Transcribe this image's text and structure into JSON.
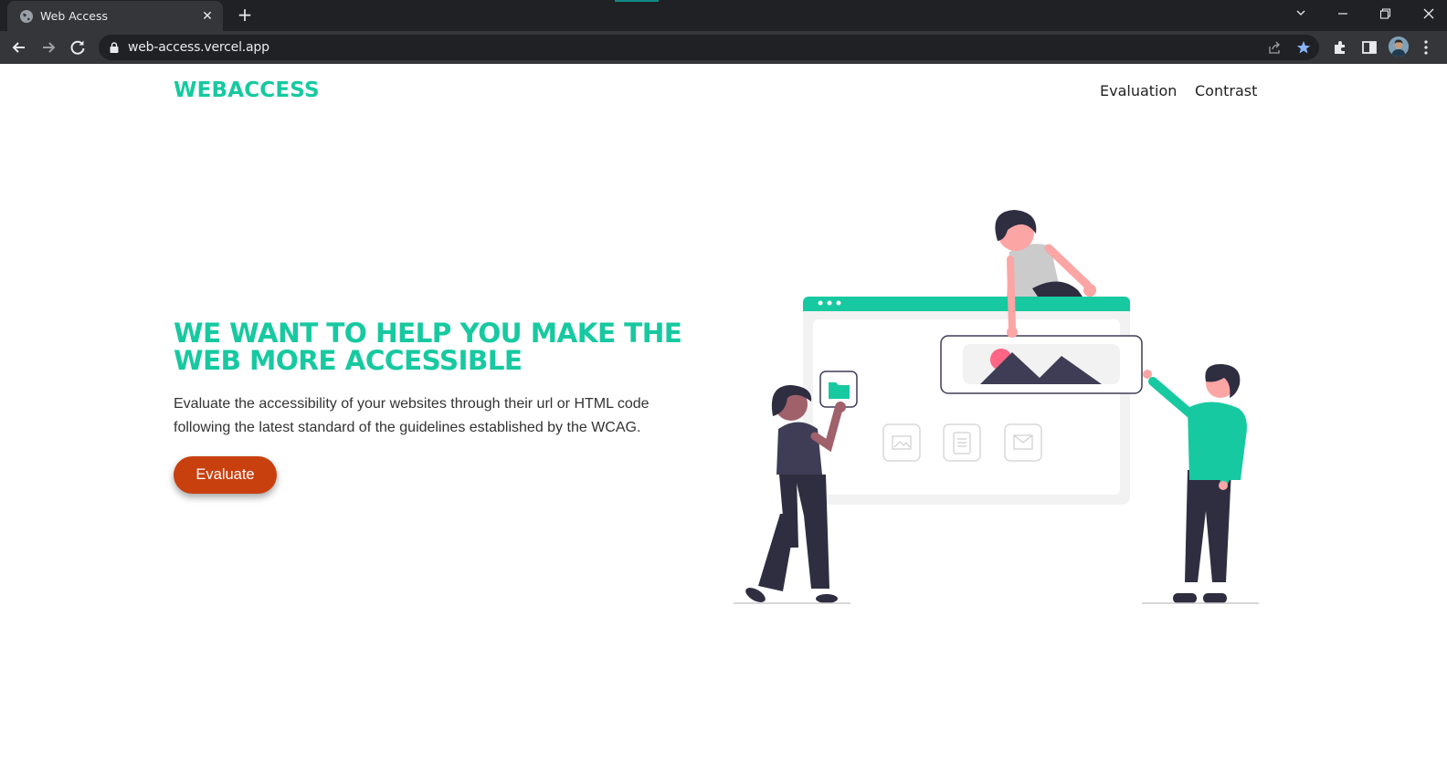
{
  "browser": {
    "tab_title": "Web Access",
    "url": "web-access.vercel.app"
  },
  "site": {
    "logo": "WEBACCESS",
    "nav": [
      {
        "label": "Evaluation"
      },
      {
        "label": "Contrast"
      }
    ]
  },
  "hero": {
    "title": "WE WANT TO HELP YOU MAKE THE WEB MORE ACCESSIBLE",
    "description": "Evaluate the accessibility of your websites through their url or HTML code following the latest standard of the guidelines established by the WCAG.",
    "button_label": "Evaluate"
  },
  "colors": {
    "brand": "#17c9a0",
    "button": "#c9400f",
    "dark": "#2f2e41"
  }
}
